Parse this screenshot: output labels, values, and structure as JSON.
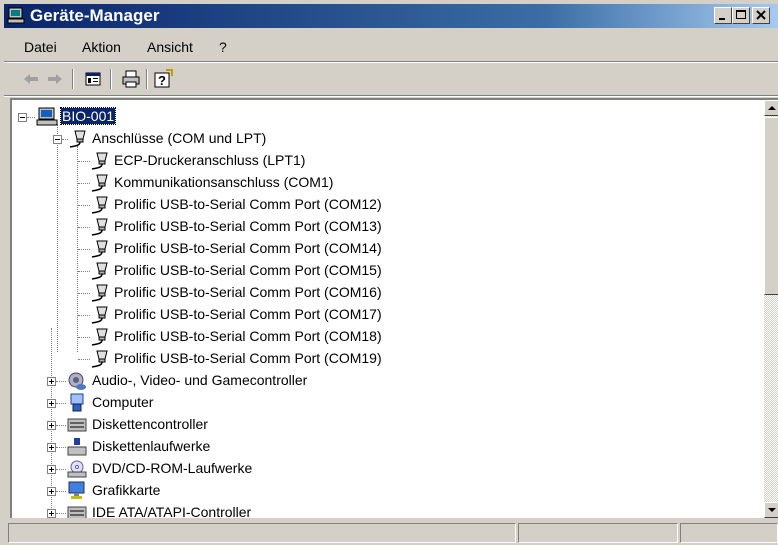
{
  "window": {
    "title": "Geräte-Manager"
  },
  "menu": {
    "items": [
      "Datei",
      "Aktion",
      "Ansicht",
      "?"
    ]
  },
  "toolbar": {
    "icons": [
      "back-arrow-icon",
      "forward-arrow-icon",
      "properties-icon",
      "print-icon",
      "help-icon"
    ]
  },
  "tree": {
    "root": "BIO-001",
    "ports_category": "Anschlüsse (COM und LPT)",
    "ports": [
      "ECP-Druckeranschluss (LPT1)",
      "Kommunikationsanschluss (COM1)",
      "Prolific USB-to-Serial Comm Port (COM12)",
      "Prolific USB-to-Serial Comm Port (COM13)",
      "Prolific USB-to-Serial Comm Port (COM14)",
      "Prolific USB-to-Serial Comm Port (COM15)",
      "Prolific USB-to-Serial Comm Port (COM16)",
      "Prolific USB-to-Serial Comm Port (COM17)",
      "Prolific USB-to-Serial Comm Port (COM18)",
      "Prolific USB-to-Serial Comm Port (COM19)"
    ],
    "categories": [
      "Audio-, Video- und Gamecontroller",
      "Computer",
      "Diskettencontroller",
      "Diskettenlaufwerke",
      "DVD/CD-ROM-Laufwerke",
      "Grafikkarte",
      "IDE ATA/ATAPI-Controller"
    ]
  },
  "colors": {
    "titlebar": "#0a246a",
    "selection": "#0a246a",
    "face": "#d4d0c8"
  }
}
